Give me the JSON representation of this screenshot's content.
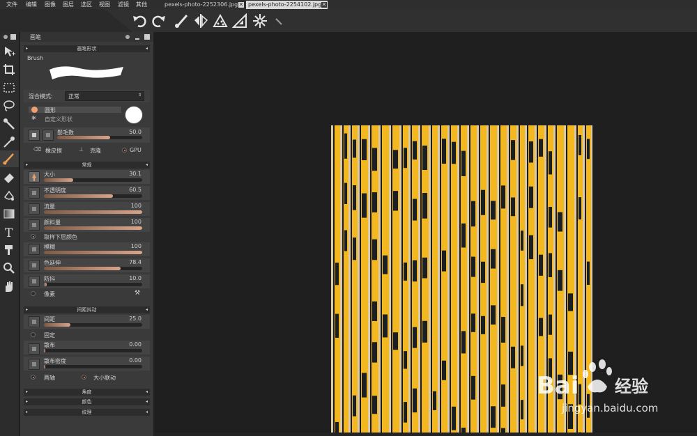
{
  "menu": [
    "文件",
    "编辑",
    "图像",
    "图层",
    "选区",
    "视图",
    "滤镜",
    "其他"
  ],
  "tabs": [
    {
      "label": "pexels-photo-2252306.jpg",
      "active": false
    },
    {
      "label": "pexels-photo-2254102.jpg",
      "active": true
    }
  ],
  "toolbar": {
    "icons": [
      "undo-icon",
      "redo-icon",
      "brush-icon",
      "symmetry-icon",
      "particles-icon",
      "ruler-icon",
      "snowflake-icon",
      "pen-icon"
    ]
  },
  "toolbox": {
    "tools": [
      "move-tool-icon",
      "crop-tool-icon",
      "rect-select-icon",
      "lasso-icon",
      "magic-wand-icon",
      "eyedropper-icon",
      "brush-tool-icon",
      "eraser-icon",
      "fill-icon",
      "gradient-icon",
      "text-tool-icon",
      "clone-stamp-icon",
      "zoom-icon",
      "hand-icon"
    ]
  },
  "panel": {
    "title": "画笔",
    "brush_shape": {
      "header": "画笔形状",
      "brush_label": "Brush",
      "blend_mode_label": "混合模式:",
      "blend_mode_value": "正常",
      "shape_circle": "圆形",
      "shape_custom": "自定义形状",
      "bristles_label": "鬃毛数",
      "bristles_value": "50.0",
      "bristles_fraction": 0.62,
      "eraser_label": "橡皮擦",
      "clone_label": "克隆",
      "gpu_label": "GPU"
    },
    "general": {
      "header": "常规",
      "size_label": "大小",
      "size_value": "30.1",
      "size_fraction": 0.3,
      "opacity_label": "不透明度",
      "opacity_value": "60.5",
      "opacity_fraction": 0.7,
      "flow_label": "流量",
      "flow_value": "100",
      "flow_fraction": 1.0,
      "paint_label": "颜料量",
      "paint_value": "100",
      "paint_fraction": 1.0,
      "sample_label": "取样下层颜色",
      "blur_label": "模糊",
      "blur_value": "100",
      "blur_fraction": 1.0,
      "smudge_label": "色延伸",
      "smudge_value": "78.4",
      "smudge_fraction": 0.78,
      "stabilizer_label": "防抖",
      "stabilizer_value": "10.0",
      "stabilizer_fraction": 0.03,
      "pixel_label": "像素"
    },
    "spacing": {
      "header": "间距抖动",
      "spacing_label": "间距",
      "spacing_value": "25.0",
      "spacing_fraction": 0.27,
      "fixed_label": "固定",
      "scatter_label": "散布",
      "scatter_value": "0.00",
      "scatter_fraction": 0.0,
      "scatter_density_label": "散布密度",
      "scatter_density_value": "0.00",
      "scatter_density_fraction": 0.0,
      "both_axes_label": "两轴",
      "size_link_label": "大小联动"
    },
    "collapsed": [
      "角度",
      "颜色",
      "纹理"
    ]
  },
  "watermark": {
    "brand": "Bai",
    "brand2": "经验",
    "url": "jingyan.baidu.com"
  }
}
